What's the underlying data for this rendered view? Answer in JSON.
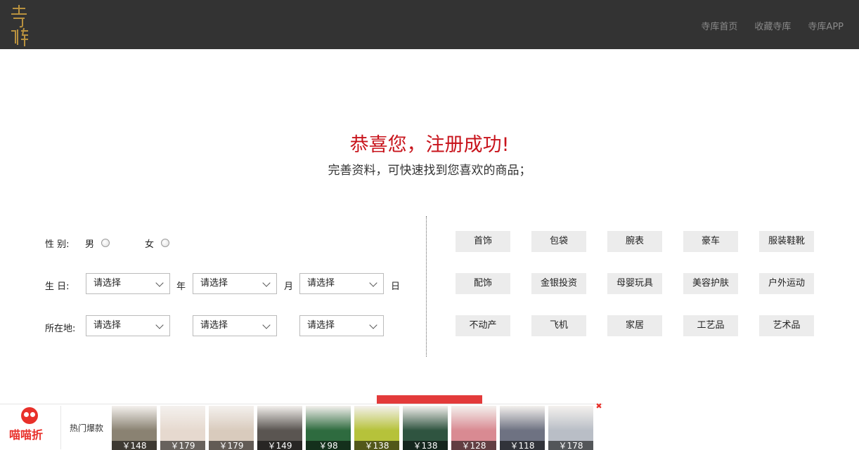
{
  "header": {
    "nav": [
      "寺库首页",
      "收藏寺库",
      "寺库APP"
    ]
  },
  "hero": {
    "title": "恭喜您，注册成功!",
    "subtitle": "完善资料，可快速找到您喜欢的商品；"
  },
  "form": {
    "gender_label": "性  别:",
    "male": "男",
    "female": "女",
    "birthday_label": "生  日:",
    "year_select": "请选择",
    "year_unit": "年",
    "month_select": "请选择",
    "month_unit": "月",
    "day_select": "请选择",
    "day_unit": "日",
    "location_label": "所在地:",
    "province_select": "请选择",
    "city_select": "请选择",
    "district_select": "请选择"
  },
  "tags": [
    "首饰",
    "包袋",
    "腕表",
    "豪车",
    "服装鞋靴",
    "配饰",
    "金银投资",
    "母婴玩具",
    "美容护肤",
    "户外运动",
    "不动产",
    "飞机",
    "家居",
    "工艺品",
    "艺术品"
  ],
  "promo": {
    "brand": "喵喵折",
    "label": "热门爆款",
    "products": [
      {
        "price": "￥148",
        "color": "#8a8272"
      },
      {
        "price": "￥179",
        "color": "#e6d9cf"
      },
      {
        "price": "￥179",
        "color": "#d9cbbd"
      },
      {
        "price": "￥149",
        "color": "#5a5551"
      },
      {
        "price": "￥98",
        "color": "#2e6b3f"
      },
      {
        "price": "￥138",
        "color": "#b6c23a"
      },
      {
        "price": "￥138",
        "color": "#2f5440"
      },
      {
        "price": "￥128",
        "color": "#d98a92"
      },
      {
        "price": "￥118",
        "color": "#6e7282"
      },
      {
        "price": "￥178",
        "color": "#b9bec6"
      }
    ]
  }
}
